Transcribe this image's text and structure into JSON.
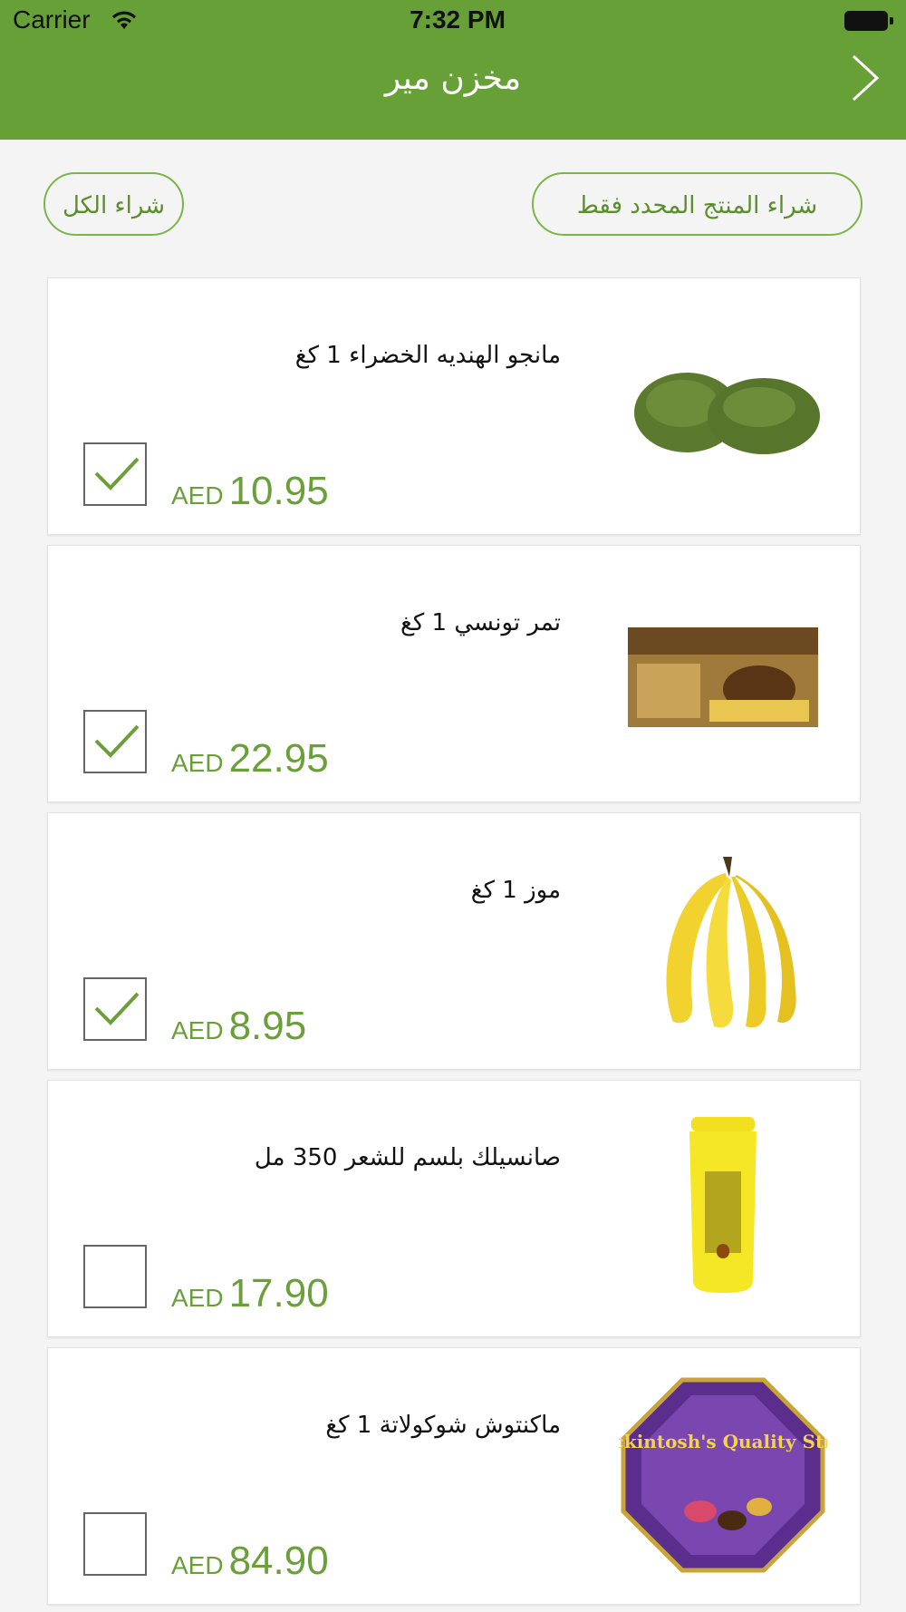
{
  "status_bar": {
    "carrier": "Carrier",
    "time": "7:32 PM"
  },
  "nav": {
    "title": "مخزن مير",
    "forward_icon": "chevron-right-icon"
  },
  "actions": {
    "buy_all": "شراء الكل",
    "buy_selected": "شراء المنتج المحدد فقط"
  },
  "colors": {
    "header": "#68a038",
    "accent": "#6a9f3a",
    "background": "#f4f4f4"
  },
  "products": [
    {
      "name": "مانجو الهنديه الخضراء 1 كغ",
      "currency": "AED",
      "price": "10.95",
      "checked": true,
      "image": "green-mango-image"
    },
    {
      "name": "تمر تونسي  1 كغ",
      "currency": "AED",
      "price": "22.95",
      "checked": true,
      "image": "dates-box-image"
    },
    {
      "name": "موز  1 كغ",
      "currency": "AED",
      "price": "8.95",
      "checked": true,
      "image": "banana-bunch-image"
    },
    {
      "name": "صانسيلك بلسم للشعر 350 مل",
      "currency": "AED",
      "price": "17.90",
      "checked": false,
      "image": "conditioner-bottle-image"
    },
    {
      "name": "ماكنتوش شوكولاتة 1 كغ",
      "currency": "AED",
      "price": "84.90",
      "checked": false,
      "image": "chocolate-tin-image",
      "image_text": "Mackintosh's Quality Street"
    }
  ]
}
